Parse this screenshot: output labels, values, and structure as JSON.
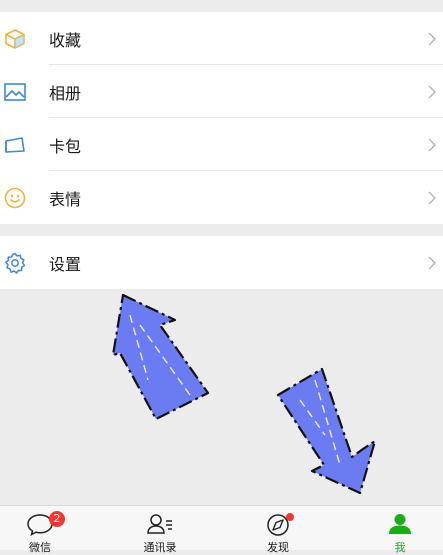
{
  "menu": {
    "items": [
      {
        "label": "收藏",
        "icon": "cube-icon",
        "color": "#f3b23c"
      },
      {
        "label": "相册",
        "icon": "photo-album-icon",
        "color": "#3f88d8"
      },
      {
        "label": "卡包",
        "icon": "card-wallet-icon",
        "color": "#3f88d8"
      },
      {
        "label": "表情",
        "icon": "smiley-icon",
        "color": "#f3b23c"
      }
    ],
    "settings": {
      "label": "设置",
      "icon": "gear-icon",
      "color": "#3f88d8"
    }
  },
  "tabbar": {
    "tabs": [
      {
        "label": "微信",
        "icon": "chat-bubble-icon",
        "badge": "2"
      },
      {
        "label": "通讯录",
        "icon": "contacts-icon"
      },
      {
        "label": "发现",
        "icon": "compass-icon"
      },
      {
        "label": "我",
        "icon": "person-icon",
        "active": true
      }
    ]
  },
  "colors": {
    "accent": "#1aad19",
    "badge": "#f43530",
    "arrow_fill": "#6b7cf2"
  }
}
